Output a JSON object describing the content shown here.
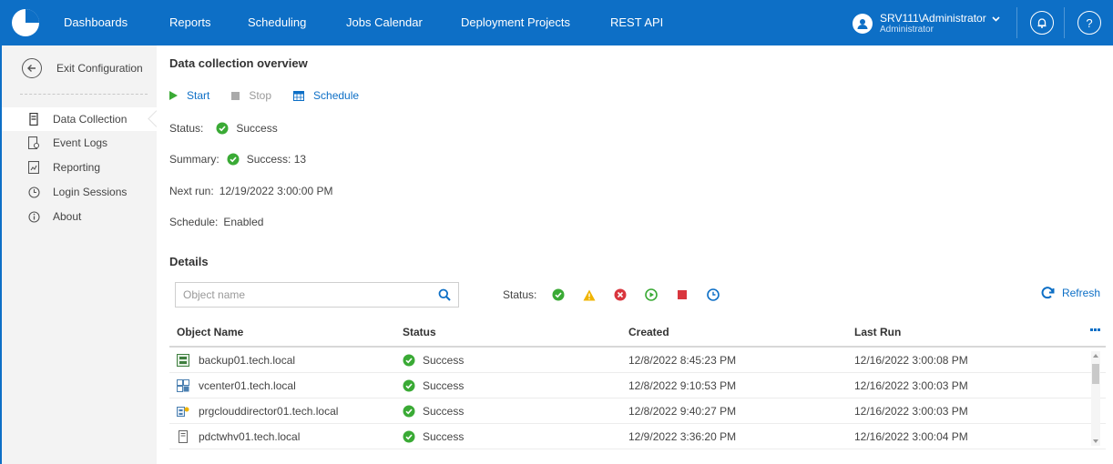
{
  "topbar": {
    "nav": [
      "Dashboards",
      "Reports",
      "Scheduling",
      "Jobs Calendar",
      "Deployment Projects",
      "REST API"
    ],
    "user_name": "SRV111\\Administrator",
    "user_role": "Administrator",
    "help_label": "?",
    "bar_color": "#0d6fc6"
  },
  "sidebar": {
    "exit_label": "Exit Configuration",
    "items": [
      {
        "label": "Data Collection",
        "icon": "server-icon",
        "active": true
      },
      {
        "label": "Event Logs",
        "icon": "event-log-icon"
      },
      {
        "label": "Reporting",
        "icon": "reporting-icon"
      },
      {
        "label": "Login Sessions",
        "icon": "clock-icon"
      },
      {
        "label": "About",
        "icon": "info-icon"
      }
    ]
  },
  "main": {
    "title": "Data collection overview",
    "actions": {
      "start": "Start",
      "stop": "Stop",
      "schedule": "Schedule"
    },
    "status_label": "Status:",
    "status_value": "Success",
    "summary_label": "Summary:",
    "summary_value": "Success: 13",
    "next_run_label": "Next run:",
    "next_run_value": "12/19/2022 3:00:00 PM",
    "schedule_label": "Schedule:",
    "schedule_value": "Enabled",
    "details_title": "Details",
    "search_placeholder": "Object name",
    "status_filter_label": "Status:",
    "refresh_label": "Refresh"
  },
  "table": {
    "headers": [
      "Object Name",
      "Status",
      "Created",
      "Last Run"
    ],
    "rows": [
      {
        "name": "backup01.tech.local",
        "icon": "backup-server-icon",
        "status": "Success",
        "created": "12/8/2022 8:45:23 PM",
        "last_run": "12/16/2022 3:00:08 PM"
      },
      {
        "name": "vcenter01.tech.local",
        "icon": "vcenter-icon",
        "status": "Success",
        "created": "12/8/2022 9:10:53 PM",
        "last_run": "12/16/2022 3:00:03 PM"
      },
      {
        "name": "prgclouddirector01.tech.local",
        "icon": "cloud-director-icon",
        "status": "Success",
        "created": "12/8/2022 9:40:27 PM",
        "last_run": "12/16/2022 3:00:03 PM"
      },
      {
        "name": "pdctwhv01.tech.local",
        "icon": "host-icon",
        "status": "Success",
        "created": "12/9/2022 3:36:20 PM",
        "last_run": "12/16/2022 3:00:04 PM"
      }
    ]
  },
  "colors": {
    "accent": "#0d6fc6",
    "success": "#3aaa35",
    "warning": "#f0b400",
    "error": "#d9363e"
  }
}
